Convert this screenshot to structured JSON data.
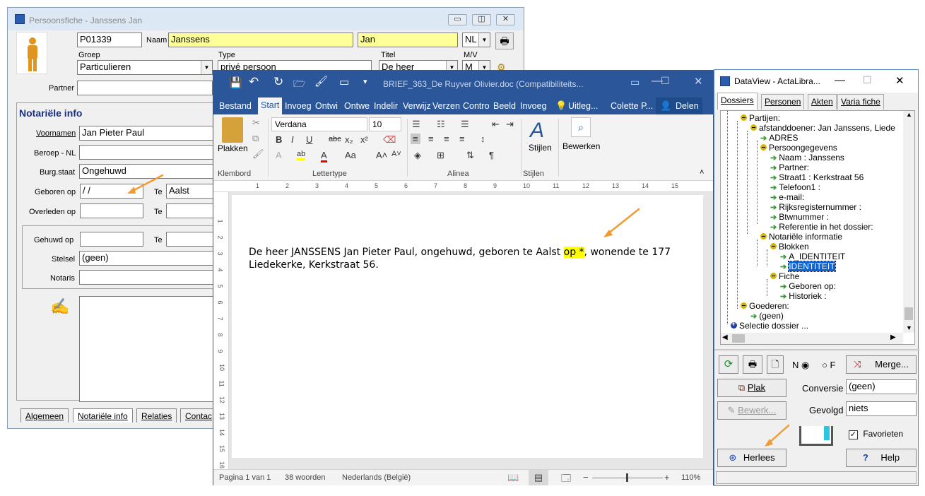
{
  "persoonsfiche": {
    "title": "Persoonsfiche - Janssens Jan",
    "id": "P01339",
    "naam_label": "Naam",
    "naam": "Janssens",
    "voornaam_short": "Jan",
    "taal": "NL",
    "groep_label": "Groep",
    "groep": "Particulieren",
    "type_label": "Type",
    "type": "privé persoon",
    "titel_label": "Titel",
    "titel": "De heer",
    "mv_label": "M/V",
    "mv": "M",
    "partner_label": "Partner",
    "section_title": "Notariële info",
    "voornamen_label": "Voornamen",
    "voornamen": "Jan Pieter Paul",
    "beroep_label": "Beroep - NL",
    "burgstaat_label": "Burg.staat",
    "burgstaat": "Ongehuwd",
    "geboren_label": "Geboren op",
    "geboren": " /  /",
    "te_label": "Te",
    "geboren_te": "Aalst",
    "overleden_label": "Overleden op",
    "gehuwd_label": "Gehuwd op",
    "stelsel_label": "Stelsel",
    "stelsel": "(geen)",
    "notaris_label": "Notaris",
    "tabs": [
      "Algemeen",
      "Notariële info",
      "Relaties",
      "Contac"
    ]
  },
  "word": {
    "title": "BRIEF_363_De Ruyver Olivier.doc (Compatibiliteits...",
    "user": "Colette P...",
    "share": "Delen",
    "tell_me": "Uitleg...",
    "tabs": [
      "Bestand",
      "Start",
      "Invoeg",
      "Ontwi",
      "Ontwe",
      "Indelir",
      "Verwijz",
      "Verzen",
      "Contro",
      "Beeld",
      "Invoeg"
    ],
    "font_name": "Verdana",
    "font_size": "10",
    "plakken": "Plakken",
    "stijlen": "Stijlen",
    "bewerken": "Bewerken",
    "groups": [
      "Klembord",
      "Lettertype",
      "Alinea",
      "Stijlen"
    ],
    "doc_line1_a": "De heer JANSSENS Jan Pieter Paul, ongehuwd, geboren te Aalst ",
    "doc_line1_hl": "op *",
    "doc_line1_b": ", wonende te 177",
    "doc_line2": "Liedekerke, Kerkstraat 56.",
    "status_page": "Pagina 1 van 1",
    "status_words": "38 woorden",
    "status_lang": "Nederlands (België)",
    "zoom": "110%",
    "ruler_numbers": [
      "1",
      "2",
      "3",
      "4",
      "5",
      "6",
      "7",
      "8",
      "9",
      "10",
      "11",
      "12",
      "13",
      "14",
      "15"
    ],
    "vruler_numbers": [
      "1",
      "2",
      "3",
      "4",
      "5",
      "6",
      "7",
      "8",
      "9",
      "10",
      "11",
      "12",
      "13",
      "14",
      "15",
      "16"
    ]
  },
  "dataview": {
    "title": "DataView - ActaLibra...",
    "tabs": [
      "Dossiers",
      "Personen",
      "Akten",
      "Varia fiche"
    ],
    "tree": {
      "partijen": "Partijen:",
      "afstanddoener": "afstanddoener: Jan Janssens, Liede",
      "adres": "ADRES",
      "persoonsgegevens": "Persoongegevens",
      "naam": "Naam :  Janssens",
      "partner": "Partner:",
      "straat": "Straat1 :  Kerkstraat 56",
      "telefoon": "Telefoon1 :",
      "email": "e-mail:",
      "rijks": "Rijksregisternummer :",
      "btw": "Btwnummer :",
      "referentie": "Referentie in het dossier:",
      "notariele": "Notariële informatie",
      "blokken": "Blokken",
      "a_identiteit": "A_IDENTITEIT",
      "identiteit": "IDENTITEIT",
      "fiche": "Fiche",
      "geboren": "Geboren op:",
      "historiek": "Historiek :",
      "goederen": "Goederen:",
      "geen": "(geen)",
      "selectie": "Selectie dossier ..."
    },
    "radio_n": "N",
    "radio_f": "F",
    "merge": "Merge...",
    "plak": "Plak",
    "conversie_label": "Conversie",
    "conversie": "(geen)",
    "bewerk": "Bewerk...",
    "gevolgd_label": "Gevolgd",
    "gevolgd": "niets",
    "favorieten": "Favorieten",
    "herlees": "Herlees",
    "help": "Help"
  }
}
